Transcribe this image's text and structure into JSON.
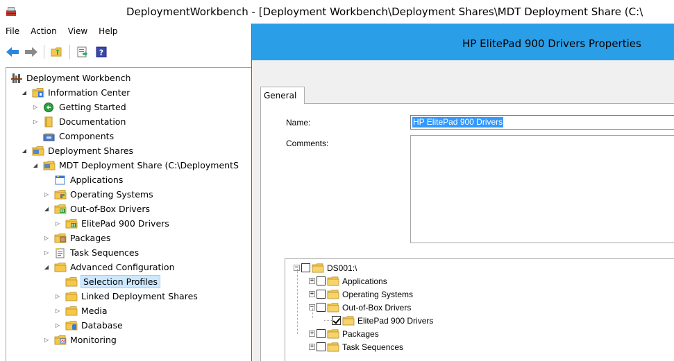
{
  "window": {
    "title": "DeploymentWorkbench - [Deployment Workbench\\Deployment Shares\\MDT Deployment Share (C:\\"
  },
  "menu": [
    "File",
    "Action",
    "View",
    "Help"
  ],
  "toolbar": {
    "icons": [
      "back-arrow-icon",
      "forward-arrow-icon",
      "up-folder-icon",
      "export-list-icon",
      "help-icon"
    ]
  },
  "tree": [
    {
      "label": "Deployment Workbench",
      "icon": "workbench-icon",
      "expander": "",
      "level": 0
    },
    {
      "label": "Information Center",
      "icon": "info-center-icon",
      "expander": "expanded",
      "level": 1
    },
    {
      "label": "Getting Started",
      "icon": "green-circle-icon",
      "expander": "collapsed",
      "level": 2
    },
    {
      "label": "Documentation",
      "icon": "book-icon",
      "expander": "collapsed",
      "level": 2
    },
    {
      "label": "Components",
      "icon": "components-icon",
      "expander": "",
      "level": 2
    },
    {
      "label": "Deployment Shares",
      "icon": "share-folder-icon",
      "expander": "expanded",
      "level": 1
    },
    {
      "label": "MDT Deployment Share (C:\\DeploymentS",
      "icon": "share-folder-icon",
      "expander": "expanded",
      "level": 2
    },
    {
      "label": "Applications",
      "icon": "applications-icon",
      "expander": "",
      "level": 3
    },
    {
      "label": "Operating Systems",
      "icon": "os-folder-icon",
      "expander": "collapsed",
      "level": 3
    },
    {
      "label": "Out-of-Box Drivers",
      "icon": "drivers-folder-icon",
      "expander": "expanded",
      "level": 3
    },
    {
      "label": "ElitePad 900 Drivers",
      "icon": "drivers-folder-icon",
      "expander": "collapsed",
      "level": 4
    },
    {
      "label": "Packages",
      "icon": "packages-folder-icon",
      "expander": "collapsed",
      "level": 3
    },
    {
      "label": "Task Sequences",
      "icon": "task-sequence-icon",
      "expander": "collapsed",
      "level": 3
    },
    {
      "label": "Advanced Configuration",
      "icon": "folder-icon",
      "expander": "expanded",
      "level": 3
    },
    {
      "label": "Selection Profiles",
      "icon": "folder-icon",
      "expander": "",
      "level": 4,
      "selected": true
    },
    {
      "label": "Linked Deployment Shares",
      "icon": "folder-icon",
      "expander": "collapsed",
      "level": 4
    },
    {
      "label": "Media",
      "icon": "folder-icon",
      "expander": "collapsed",
      "level": 4
    },
    {
      "label": "Database",
      "icon": "database-folder-icon",
      "expander": "collapsed",
      "level": 4
    },
    {
      "label": "Monitoring",
      "icon": "monitoring-folder-icon",
      "expander": "collapsed",
      "level": 3
    }
  ],
  "dialog": {
    "title": "HP ElitePad 900 Drivers Properties",
    "tab": "General",
    "name_label": "Name:",
    "name_value": "HP ElitePad 900 Drivers",
    "comments_label": "Comments:",
    "comments_value": ""
  },
  "profile_tree": [
    {
      "label": "DS001:\\",
      "level": 0,
      "expander": "minus",
      "checked": false
    },
    {
      "label": "Applications",
      "level": 1,
      "expander": "plus",
      "checked": false
    },
    {
      "label": "Operating Systems",
      "level": 1,
      "expander": "plus",
      "checked": false
    },
    {
      "label": "Out-of-Box Drivers",
      "level": 1,
      "expander": "minus",
      "checked": false
    },
    {
      "label": "ElitePad 900 Drivers",
      "level": 2,
      "expander": "",
      "checked": true
    },
    {
      "label": "Packages",
      "level": 1,
      "expander": "plus",
      "checked": false
    },
    {
      "label": "Task Sequences",
      "level": 1,
      "expander": "plus",
      "checked": false
    }
  ],
  "colors": {
    "dialog_title_bar": "#2b9ee8",
    "selection_highlight": "#cce8ff",
    "text_selection": "#3399ff",
    "folder_yellow": "#f5c84c"
  }
}
